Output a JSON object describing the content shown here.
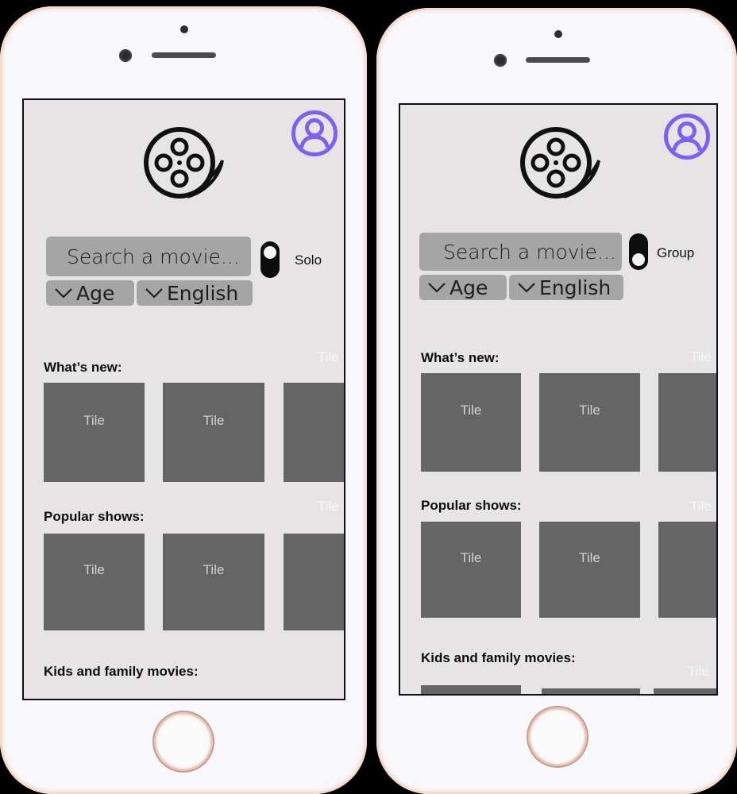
{
  "phones": [
    {
      "search_placeholder": "Search a movie...",
      "filter_age": "Age",
      "filter_language": "English",
      "mode_label": "Solo",
      "sections": [
        {
          "title": "What’s new:",
          "tiles": [
            "Tile",
            "Tile",
            "Tile"
          ],
          "ghost": "Tile"
        },
        {
          "title": "Popular shows:",
          "tiles": [
            "Tile",
            "Tile",
            "Tile"
          ],
          "ghost": "Tile"
        },
        {
          "title": "Kids and family movies:"
        }
      ]
    },
    {
      "search_placeholder": "Search a movie...",
      "filter_age": "Age",
      "filter_language": "English",
      "mode_label": "Group",
      "sections": [
        {
          "title": "What’s new:",
          "tiles": [
            "Tile",
            "Tile",
            "Tile"
          ],
          "ghost": "Tile"
        },
        {
          "title": "Popular shows:",
          "tiles": [
            "Tile",
            "Tile",
            "Tile"
          ],
          "ghost": "Tile"
        },
        {
          "title": "Kids and family movies:",
          "ghost": "Tile"
        }
      ]
    }
  ],
  "colors": {
    "profile_accent": "#7b61f0",
    "screen_bg": "#e7e4e5",
    "search_bg": "#a5a5a5",
    "tile_bg": "#656565"
  },
  "icons": [
    "film-reel-icon",
    "profile-icon",
    "chevron-down-icon",
    "toggle-switch"
  ]
}
